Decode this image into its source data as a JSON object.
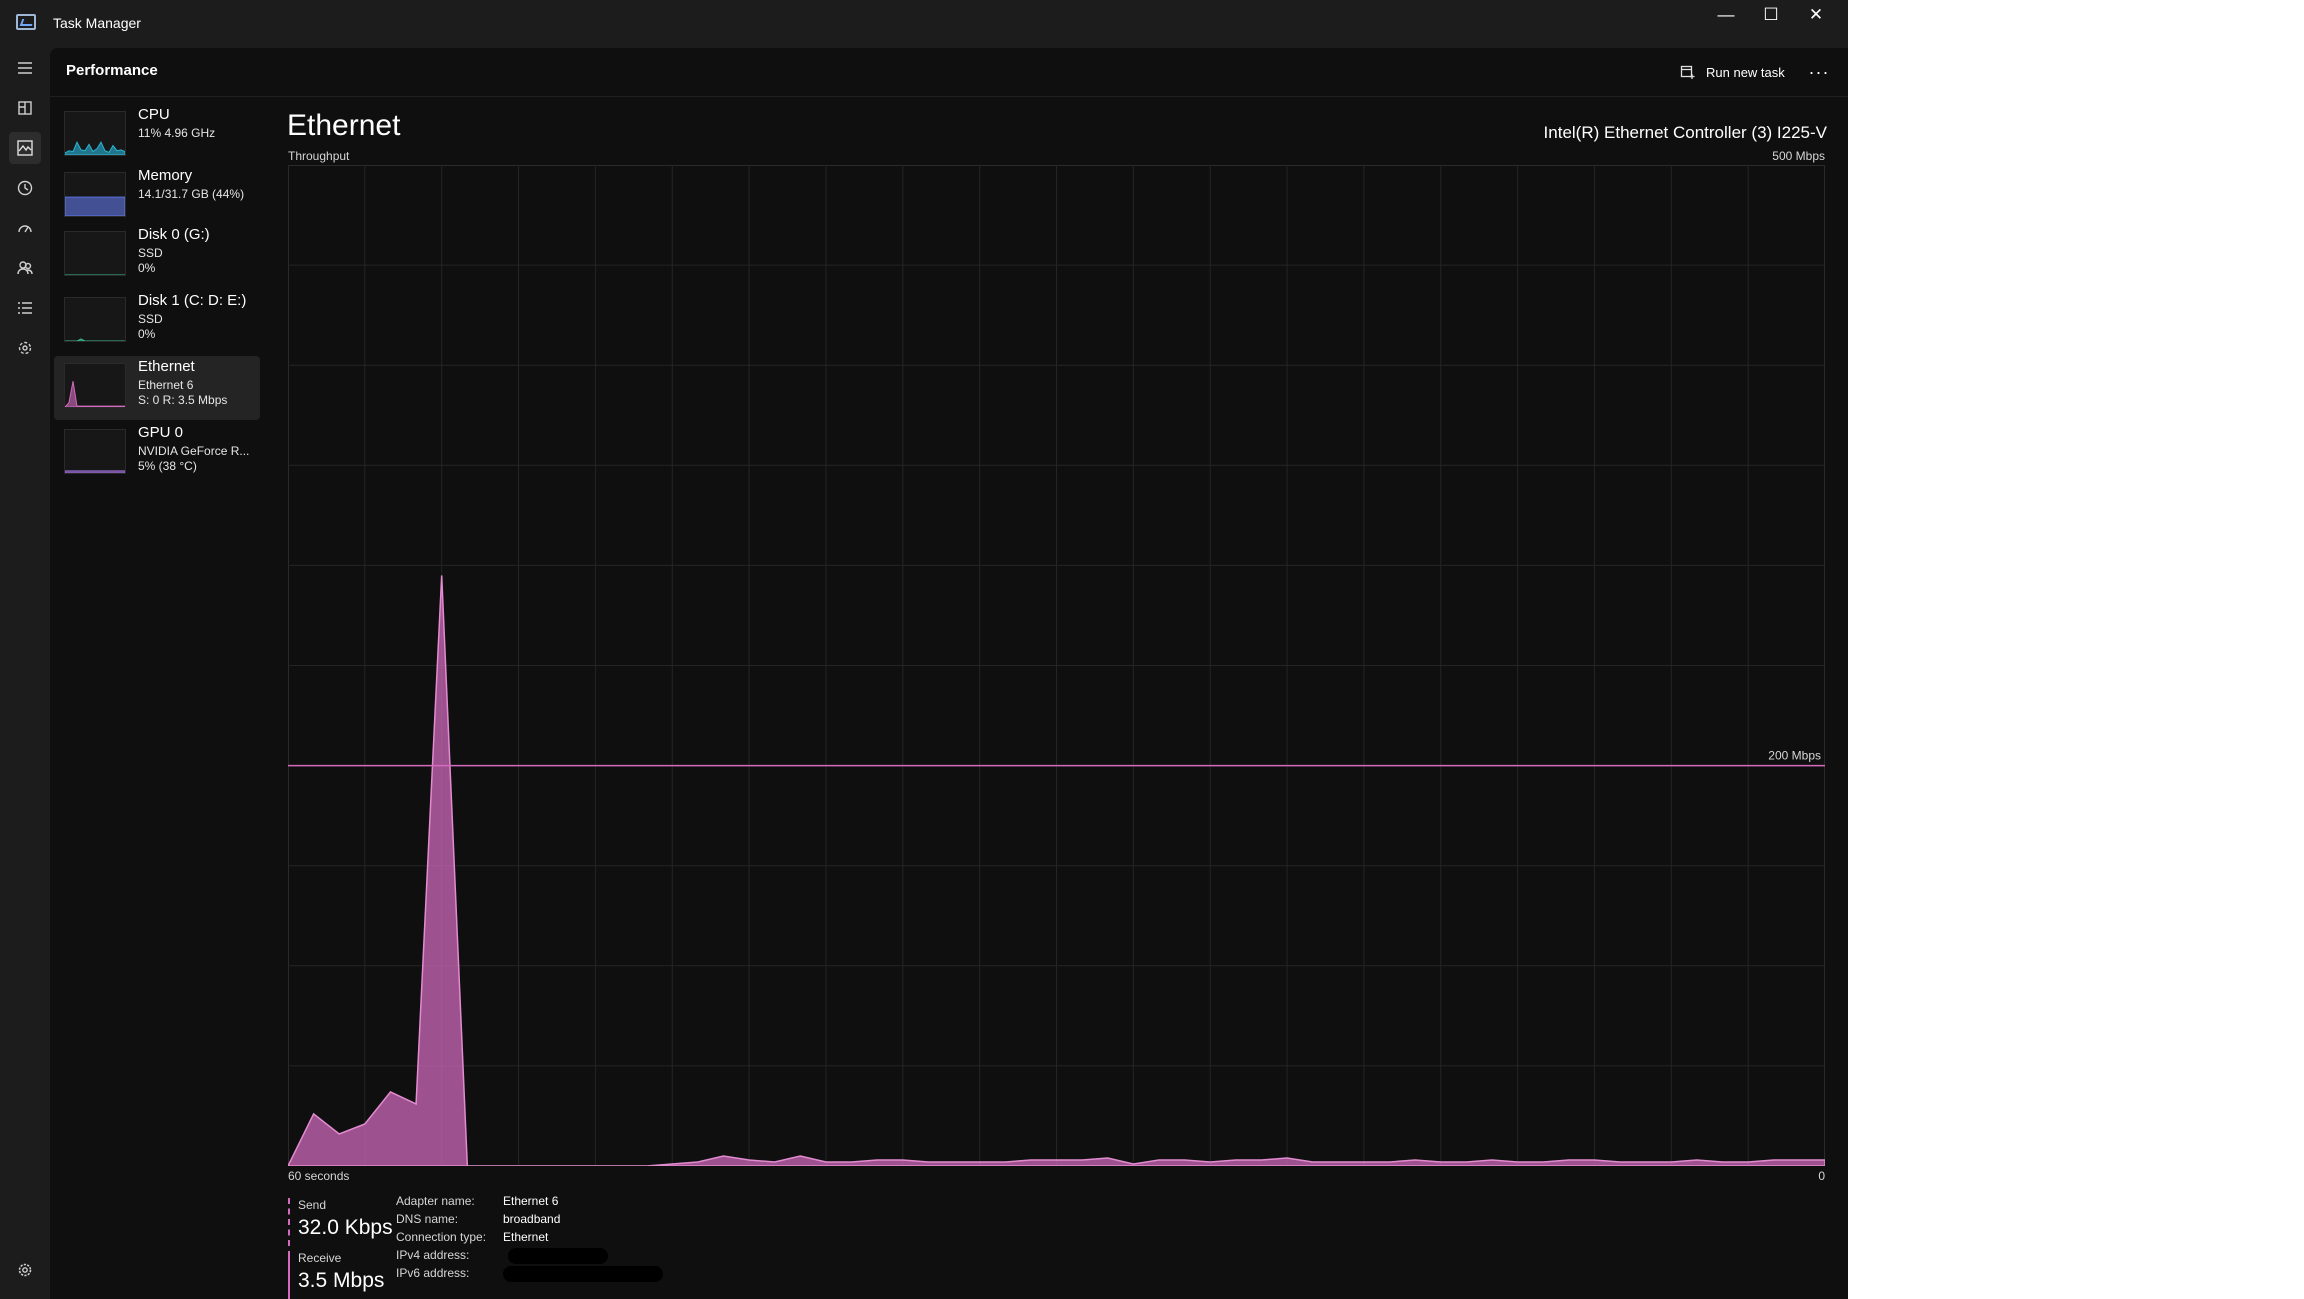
{
  "window": {
    "title": "Task Manager",
    "minimize_glyph": "—",
    "maximize_glyph": "☐",
    "close_glyph": "✕"
  },
  "nav": {
    "items": [
      {
        "name": "hamburger-menu-icon"
      },
      {
        "name": "processes-icon"
      },
      {
        "name": "performance-icon",
        "active": true
      },
      {
        "name": "app-history-icon"
      },
      {
        "name": "startup-apps-icon"
      },
      {
        "name": "users-icon"
      },
      {
        "name": "details-icon"
      },
      {
        "name": "services-icon"
      }
    ],
    "settings_icon": "settings-gear-icon"
  },
  "header": {
    "page_title": "Performance",
    "run_task_label": "Run new task",
    "more_label": "···"
  },
  "sidebar": {
    "items": [
      {
        "name": "CPU",
        "line1": "11% 4.96 GHz",
        "line2": "",
        "color": "#29b6d8",
        "thumb": [
          0.05,
          0.1,
          0.08,
          0.3,
          0.12,
          0.1,
          0.25,
          0.08,
          0.15,
          0.3,
          0.1,
          0.06,
          0.22,
          0.1,
          0.12,
          0.08
        ]
      },
      {
        "name": "Memory",
        "line1": "14.1/31.7 GB (44%)",
        "line2": "",
        "color": "#6078e8",
        "thumb": [
          0.44,
          0.44,
          0.44,
          0.44,
          0.44,
          0.44,
          0.44,
          0.44,
          0.44,
          0.44,
          0.44,
          0.44,
          0.44,
          0.44,
          0.44,
          0.44
        ]
      },
      {
        "name": "Disk 0 (G:)",
        "line1": "SSD",
        "line2": "0%",
        "color": "#37b88a",
        "thumb": [
          0,
          0,
          0,
          0,
          0,
          0,
          0,
          0,
          0,
          0,
          0,
          0,
          0,
          0,
          0,
          0
        ]
      },
      {
        "name": "Disk 1 (C: D: E:)",
        "line1": "SSD",
        "line2": "0%",
        "color": "#37b88a",
        "thumb": [
          0,
          0,
          0,
          0,
          0.05,
          0,
          0,
          0,
          0,
          0,
          0,
          0,
          0,
          0,
          0,
          0
        ]
      },
      {
        "name": "Ethernet",
        "line1": "Ethernet 6",
        "line2": "S: 0 R: 3.5 Mbps",
        "color": "#d46bbf",
        "selected": true,
        "thumb": [
          0,
          0.1,
          0.6,
          0.02,
          0.02,
          0.02,
          0.02,
          0.02,
          0.02,
          0.02,
          0.02,
          0.02,
          0.02,
          0.02,
          0.02,
          0.02
        ]
      },
      {
        "name": "GPU 0",
        "line1": "NVIDIA GeForce R...",
        "line2": "5% (38 °C)",
        "color": "#9a6bd4",
        "thumb": [
          0.05,
          0.05,
          0.05,
          0.05,
          0.05,
          0.05,
          0.05,
          0.05,
          0.05,
          0.05,
          0.05,
          0.05,
          0.05,
          0.05,
          0.05,
          0.05
        ]
      }
    ]
  },
  "main": {
    "title": "Ethernet",
    "device": "Intel(R) Ethernet Controller (3) I225-V",
    "chart_label": "Throughput",
    "y_max_label": "500 Mbps",
    "marker_label": "200 Mbps",
    "x_left_label": "60 seconds",
    "x_right_label": "0"
  },
  "chart_data": {
    "type": "area",
    "title": "Throughput",
    "xlabel": "60 seconds",
    "ylabel": "",
    "xlim": [
      60,
      0
    ],
    "ylim": [
      0,
      500
    ],
    "unit": "Mbps",
    "reference_line": 200,
    "color": "#d46bbf",
    "series": [
      {
        "x": [
          60,
          59,
          58,
          57,
          56,
          55,
          54,
          53,
          52,
          51,
          50,
          49,
          48,
          47,
          46,
          45,
          44,
          43,
          42,
          41,
          40,
          39,
          38,
          37,
          36,
          35,
          34,
          33,
          32,
          31,
          30,
          29,
          28,
          27,
          26,
          25,
          24,
          23,
          22,
          21,
          20,
          19,
          18,
          17,
          16,
          15,
          14,
          13,
          12,
          11,
          10,
          9,
          8,
          7,
          6,
          5,
          4,
          3,
          2,
          1,
          0
        ],
        "values": [
          0,
          26,
          16,
          21,
          37,
          31,
          295,
          0,
          0,
          0,
          0,
          0,
          0,
          0,
          0,
          1,
          2,
          5,
          3,
          2,
          5,
          2,
          2,
          3,
          3,
          2,
          2,
          2,
          2,
          3,
          3,
          3,
          4,
          1,
          3,
          3,
          2,
          3,
          3,
          4,
          2,
          2,
          2,
          2,
          3,
          2,
          2,
          3,
          2,
          2,
          3,
          3,
          2,
          2,
          2,
          3,
          2,
          2,
          3,
          3,
          3
        ]
      }
    ]
  },
  "stats": {
    "send_label": "Send",
    "send_value": "32.0 Kbps",
    "receive_label": "Receive",
    "receive_value": "3.5 Mbps",
    "adapter_name_key": "Adapter name:",
    "adapter_name_val": "Ethernet 6",
    "dns_key": "DNS name:",
    "dns_val": "broadband",
    "conn_type_key": "Connection type:",
    "conn_type_val": "Ethernet",
    "ipv4_key": "IPv4 address:",
    "ipv6_key": "IPv6 address:"
  },
  "colors": {
    "accent": "#d46bbf",
    "background": "#0f0f10",
    "grid": "#252525"
  }
}
